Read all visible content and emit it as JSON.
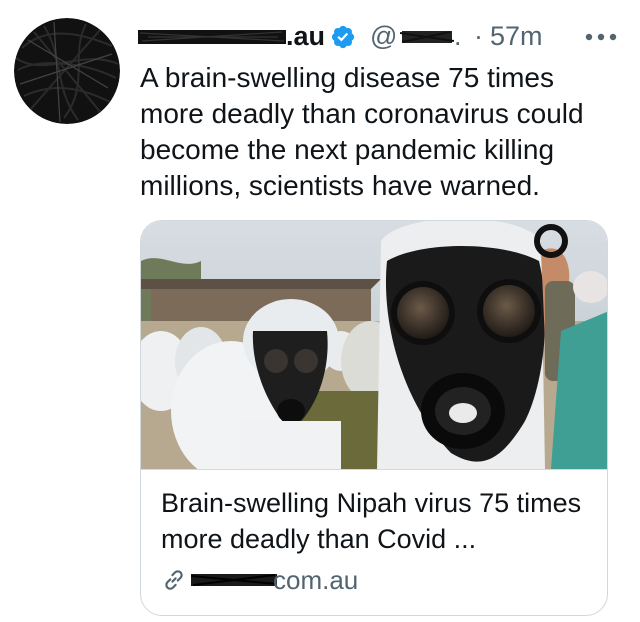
{
  "tweet": {
    "display_name_suffix": ".au",
    "handle_prefix": "@",
    "handle_ellipsis": ".",
    "separator": "·",
    "timestamp": "57m",
    "text": "A brain-swelling disease 75 times more deadly than coronavirus could become the next pandemic killing millions, scientists have warned.",
    "verified": true,
    "more_icon": "more-dots-icon"
  },
  "card": {
    "title": "Brain-swelling Nipah virus 75 times more deadly than Covid ...",
    "domain_suffix": "com.au",
    "link_icon": "link-icon",
    "image_subject": "people wearing gas masks and white protective suits"
  },
  "colors": {
    "text_primary": "#0f1419",
    "text_secondary": "#536471",
    "verified_blue": "#1d9bf0",
    "card_border": "#cfd9de"
  }
}
